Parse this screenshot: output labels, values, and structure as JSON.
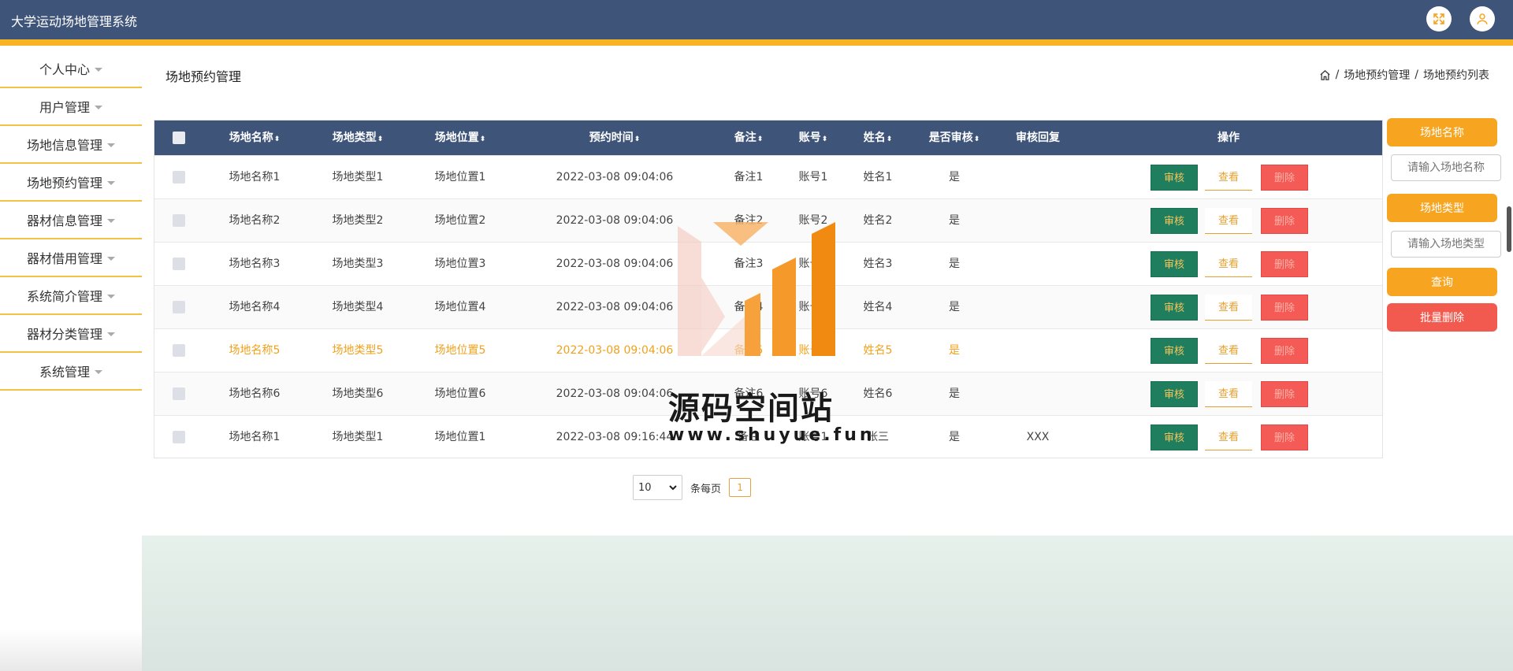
{
  "header": {
    "title": "大学运动场地管理系统"
  },
  "sidebar": {
    "items": [
      {
        "label": "个人中心"
      },
      {
        "label": "用户管理"
      },
      {
        "label": "场地信息管理"
      },
      {
        "label": "场地预约管理"
      },
      {
        "label": "器材信息管理"
      },
      {
        "label": "器材借用管理"
      },
      {
        "label": "系统简介管理"
      },
      {
        "label": "器材分类管理"
      },
      {
        "label": "系统管理"
      }
    ]
  },
  "page": {
    "title": "场地预约管理",
    "breadcrumb": [
      "场地预约管理",
      "场地预约列表"
    ],
    "breadcrumb_sep": "/"
  },
  "table": {
    "columns": [
      "场地名称",
      "场地类型",
      "场地位置",
      "预约时间",
      "备注",
      "账号",
      "姓名",
      "是否审核",
      "审核回复",
      "操作"
    ],
    "sort_glyph": "⬍",
    "rows": [
      [
        "场地名称1",
        "场地类型1",
        "场地位置1",
        "2022-03-08 09:04:06",
        "备注1",
        "账号1",
        "姓名1",
        "是",
        ""
      ],
      [
        "场地名称2",
        "场地类型2",
        "场地位置2",
        "2022-03-08 09:04:06",
        "备注2",
        "账号2",
        "姓名2",
        "是",
        ""
      ],
      [
        "场地名称3",
        "场地类型3",
        "场地位置3",
        "2022-03-08 09:04:06",
        "备注3",
        "账号3",
        "姓名3",
        "是",
        ""
      ],
      [
        "场地名称4",
        "场地类型4",
        "场地位置4",
        "2022-03-08 09:04:06",
        "备注4",
        "账号4",
        "姓名4",
        "是",
        ""
      ],
      [
        "场地名称5",
        "场地类型5",
        "场地位置5",
        "2022-03-08 09:04:06",
        "备注5",
        "账号5",
        "姓名5",
        "是",
        ""
      ],
      [
        "场地名称6",
        "场地类型6",
        "场地位置6",
        "2022-03-08 09:04:06",
        "备注6",
        "账号6",
        "姓名6",
        "是",
        ""
      ],
      [
        "场地名称1",
        "场地类型1",
        "场地位置1",
        "2022-03-08 09:16:44",
        "备注",
        "账号1",
        "张三",
        "是",
        "XXX"
      ]
    ],
    "highlighted_row": 4,
    "actions": {
      "audit": "审核",
      "view": "查看",
      "delete": "删除"
    }
  },
  "pager": {
    "page_size": "10",
    "per_page_label": "条每页",
    "current_page": "1"
  },
  "filters": {
    "name_label": "场地名称",
    "name_placeholder": "请输入场地名称",
    "type_label": "场地类型",
    "type_placeholder": "请输入场地类型",
    "query_button": "查询",
    "batch_delete_button": "批量删除"
  },
  "watermark": {
    "text": "源码空间站",
    "url": "www.shuyue.fun"
  },
  "colors": {
    "header": "#3f5479",
    "accent": "#f7b322",
    "audit_button": "#1e7e5d",
    "delete_button": "#f45b57",
    "highlight_text": "#f0a11c"
  },
  "icons": [
    "fullscreen-icon",
    "user-icon",
    "home-icon",
    "caret-down-icon"
  ]
}
